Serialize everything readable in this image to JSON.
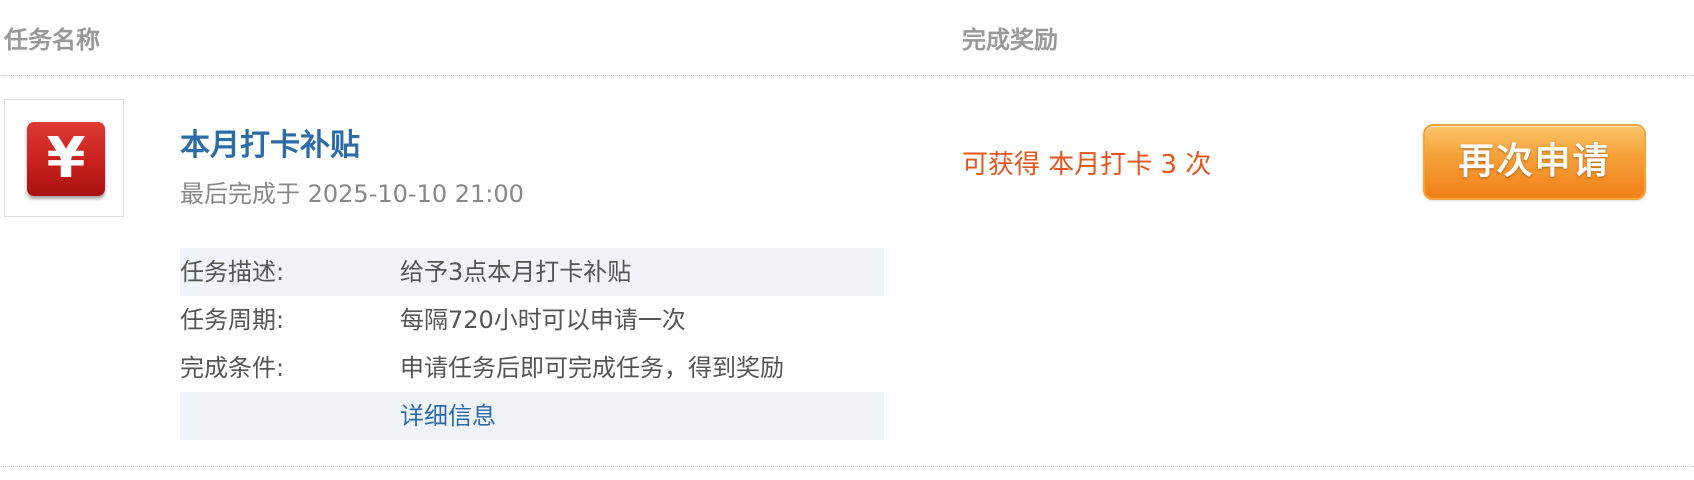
{
  "header": {
    "task_name_label": "任务名称",
    "reward_label": "完成奖励"
  },
  "task": {
    "icon": "yen-icon",
    "icon_glyph": "¥",
    "icon_color": "#c8201c",
    "title": "本月打卡补贴",
    "last_completed": "最后完成于 2025-10-10 21:00",
    "details": [
      {
        "label": "任务描述:",
        "value": "给予3点本月打卡补贴"
      },
      {
        "label": "任务周期:",
        "value": "每隔720小时可以申请一次"
      },
      {
        "label": "完成条件:",
        "value": "申请任务后即可完成任务，得到奖励"
      },
      {
        "label": "",
        "value": "详细信息"
      }
    ],
    "reward": "可获得 本月打卡 3 次",
    "action_label": "再次申请"
  },
  "colors": {
    "link": "#2b6ca8",
    "reward": "#e4561b",
    "button": "#f28018",
    "alt_row": "#f0f4f9"
  }
}
